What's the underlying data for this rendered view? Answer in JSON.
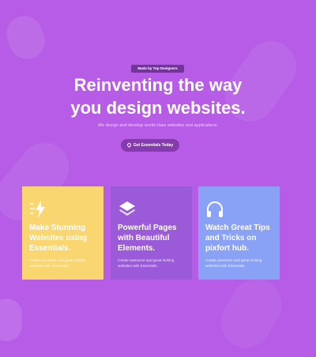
{
  "hero": {
    "badge": "Made by Top Designers",
    "headline_line1": "Reinventing the way",
    "headline_line2": "you design websites.",
    "subtitle": "We design and develop world-class websites and applications.",
    "cta_label": "Get Essentials Today"
  },
  "cards": [
    {
      "icon": "lightning-icon",
      "title": "Make Stunning Websites using Essentials.",
      "desc": "Create awesome and great looking websites with Essentials.",
      "color": "#f9d66f"
    },
    {
      "icon": "layers-icon",
      "title": "Powerful Pages with Beautiful Elements.",
      "desc": "Create awesome and great looking websites with Essentials.",
      "color": "#9b5ad8"
    },
    {
      "icon": "headphones-icon",
      "title": "Watch Great Tips and Tricks on pixfort hub.",
      "desc": "Create awesome and great looking websites with Essentials.",
      "color": "#8aa2f6"
    }
  ],
  "colors": {
    "background": "#b65ce6",
    "accent_yellow": "#f9d66f",
    "accent_purple": "#9b5ad8",
    "accent_blue": "#8aa2f6"
  }
}
